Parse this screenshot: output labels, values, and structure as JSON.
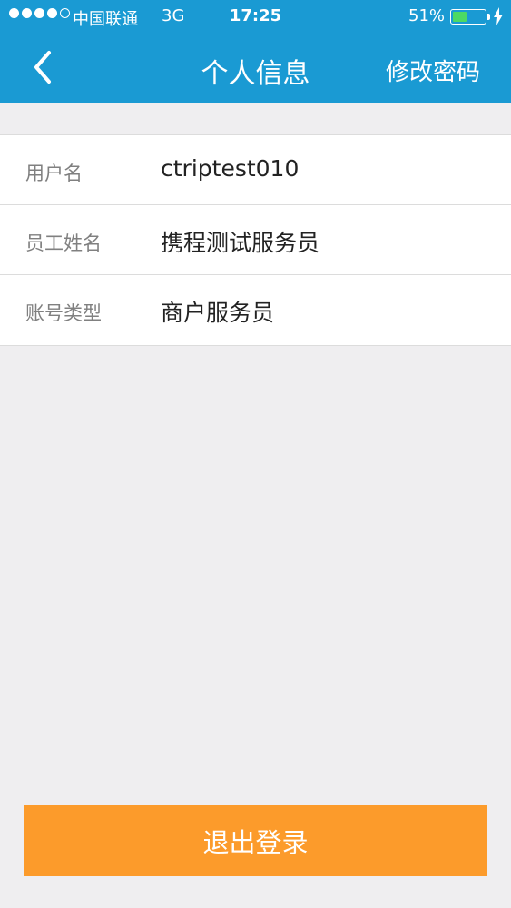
{
  "status_bar": {
    "carrier": "中国联通",
    "network": "3G",
    "time": "17:25",
    "battery_percent": "51%",
    "battery_level": 0.51
  },
  "nav": {
    "back_icon": "chevron-left-icon",
    "title": "个人信息",
    "right_action": "修改密码"
  },
  "info": [
    {
      "label": "用户名",
      "value": "ctriptest010"
    },
    {
      "label": "员工姓名",
      "value": "携程测试服务员"
    },
    {
      "label": "账号类型",
      "value": "商户服务员"
    }
  ],
  "logout_label": "退出登录",
  "colors": {
    "header": "#1a9ad3",
    "logout": "#fc9b2b",
    "background": "#efeef0"
  }
}
